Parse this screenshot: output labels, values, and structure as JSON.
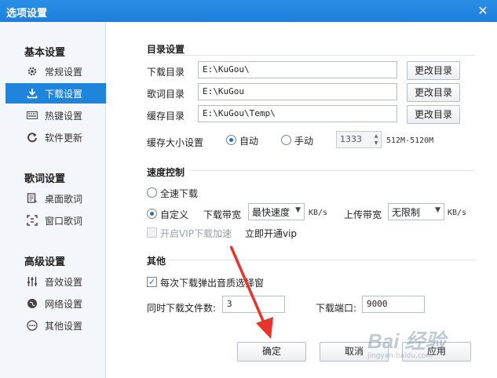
{
  "window": {
    "title": "选项设置",
    "close_glyph": "✕"
  },
  "sidebar": {
    "groups": [
      {
        "title": "基本设置",
        "items": [
          {
            "label": "常规设置",
            "icon": "gear-icon"
          },
          {
            "label": "下载设置",
            "icon": "download-icon",
            "active": true
          },
          {
            "label": "热键设置",
            "icon": "keyboard-icon"
          },
          {
            "label": "软件更新",
            "icon": "refresh-icon"
          }
        ]
      },
      {
        "title": "歌词设置",
        "items": [
          {
            "label": "桌面歌词",
            "icon": "desktop-lyrics-icon"
          },
          {
            "label": "窗口歌词",
            "icon": "window-lyrics-icon"
          }
        ]
      },
      {
        "title": "高级设置",
        "items": [
          {
            "label": "音效设置",
            "icon": "equalizer-icon"
          },
          {
            "label": "网络设置",
            "icon": "network-icon"
          },
          {
            "label": "其他设置",
            "icon": "more-icon"
          }
        ]
      }
    ]
  },
  "dir": {
    "title": "目录设置",
    "download": {
      "label": "下载目录",
      "value": "E:\\KuGou\\",
      "button": "更改目录"
    },
    "lyrics": {
      "label": "歌词目录",
      "value": "E:\\KuGou",
      "button": "更改目录"
    },
    "cache": {
      "label": "缓存目录",
      "value": "E:\\KuGou\\Temp\\",
      "button": "更改目录"
    },
    "cache_size": {
      "label": "缓存大小设置",
      "auto": "自动",
      "manual": "手动",
      "value": "1333",
      "range": "512M-5120M"
    }
  },
  "speed": {
    "title": "速度控制",
    "full": "全速下载",
    "custom": "自定义",
    "down_label": "下载带宽",
    "down_value": "最快速度",
    "unit": "KB/s",
    "up_label": "上传带宽",
    "up_value": "无限制",
    "vip_check": "开启VIP下载加速",
    "vip_link": "立即开通vip"
  },
  "other": {
    "title": "其他",
    "popup_check": "每次下载弹出音质选择窗",
    "concurrent_label": "同时下载文件数:",
    "concurrent_value": "3",
    "port_label": "下载端口:",
    "port_value": "9000"
  },
  "footer": {
    "ok": "确定",
    "cancel": "取消",
    "apply": "应用"
  },
  "watermark": {
    "text": "Bai 经验",
    "sub": "jingyan.baidu.com"
  },
  "colors": {
    "accent": "#1f85dc",
    "arrow": "#e8352b"
  }
}
